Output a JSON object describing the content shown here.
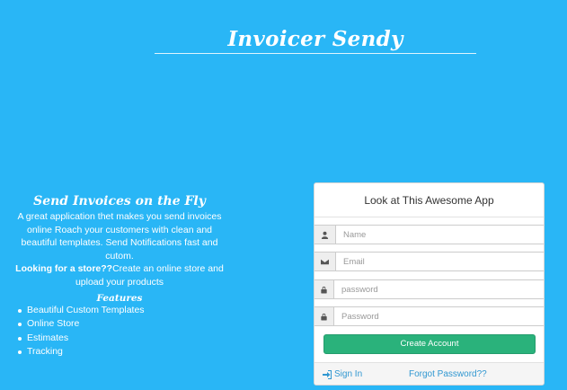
{
  "brand": {
    "title": "Invoicer Sendy"
  },
  "hero": {
    "title": "Send Invoices on the Fly",
    "description": "A great application thet makes you send invoices online Roach your customers with clean and beautiful templates. Send Notifications fast and cutom.",
    "store_bold": "Looking for a store??",
    "store_text": "Create an online store and upload your products",
    "features_title": "Features",
    "features": [
      "Beautiful Custom Templates",
      "Online Store",
      "Estimates",
      "Tracking"
    ]
  },
  "card": {
    "title": "Look at This Awesome App",
    "fields": {
      "name": {
        "placeholder": "Name",
        "icon": "user-icon"
      },
      "email": {
        "placeholder": "Email",
        "icon": "envelope-icon"
      },
      "password": {
        "placeholder": "password",
        "icon": "lock-icon"
      },
      "password_confirm": {
        "placeholder": "Password",
        "icon": "lock-icon"
      }
    },
    "create_label": "Create Account",
    "signin_label": "Sign In",
    "forgot_label": "Forgot Password??"
  },
  "colors": {
    "background": "#29b6f6",
    "button_green": "#2ab27b",
    "link_blue": "#3097d1"
  }
}
